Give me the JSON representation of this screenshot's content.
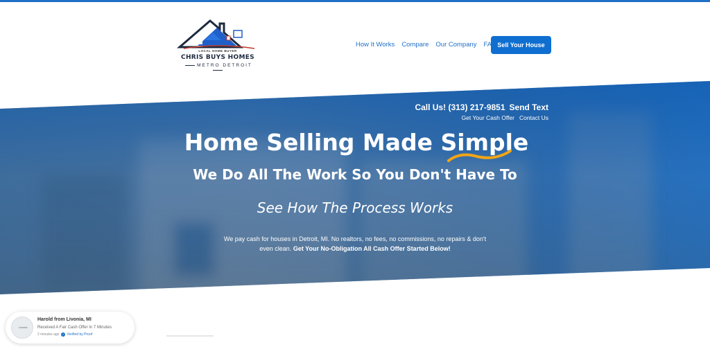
{
  "header": {
    "logo_small": "LOCAL HOME BUYER",
    "logo_main": "CHRIS BUYS HOMES",
    "logo_sub": "METRO DETROIT",
    "nav": [
      "How It Works",
      "Compare",
      "Our Company",
      "FAQ"
    ],
    "cta": "Sell Your House"
  },
  "hero": {
    "call": "Call Us! (313) 217-9851",
    "send_text": "Send Text",
    "link_offer": "Get Your Cash Offer",
    "link_contact": "Contact Us",
    "headline": "Home Selling Made Simple",
    "subhead": "We Do All The Work So You Don't Have To",
    "process": "See How The Process Works",
    "desc_plain": "We pay cash for houses in Detroit, MI. No realtors, no fees, no commissions, no repairs & don't even clean.",
    "desc_bold": "Get Your No-Obligation All Cash Offer Started Below!"
  },
  "proof": {
    "avatar_label": "Livonia",
    "name": "Harold from Livonia, MI",
    "message": "Received A Fair Cash Offer In 7 Minutes",
    "time": "2 minutes ago",
    "verified": "Verified by Proof"
  },
  "colors": {
    "brand_blue": "#0f6fd1",
    "accent_orange": "#f2a516"
  }
}
